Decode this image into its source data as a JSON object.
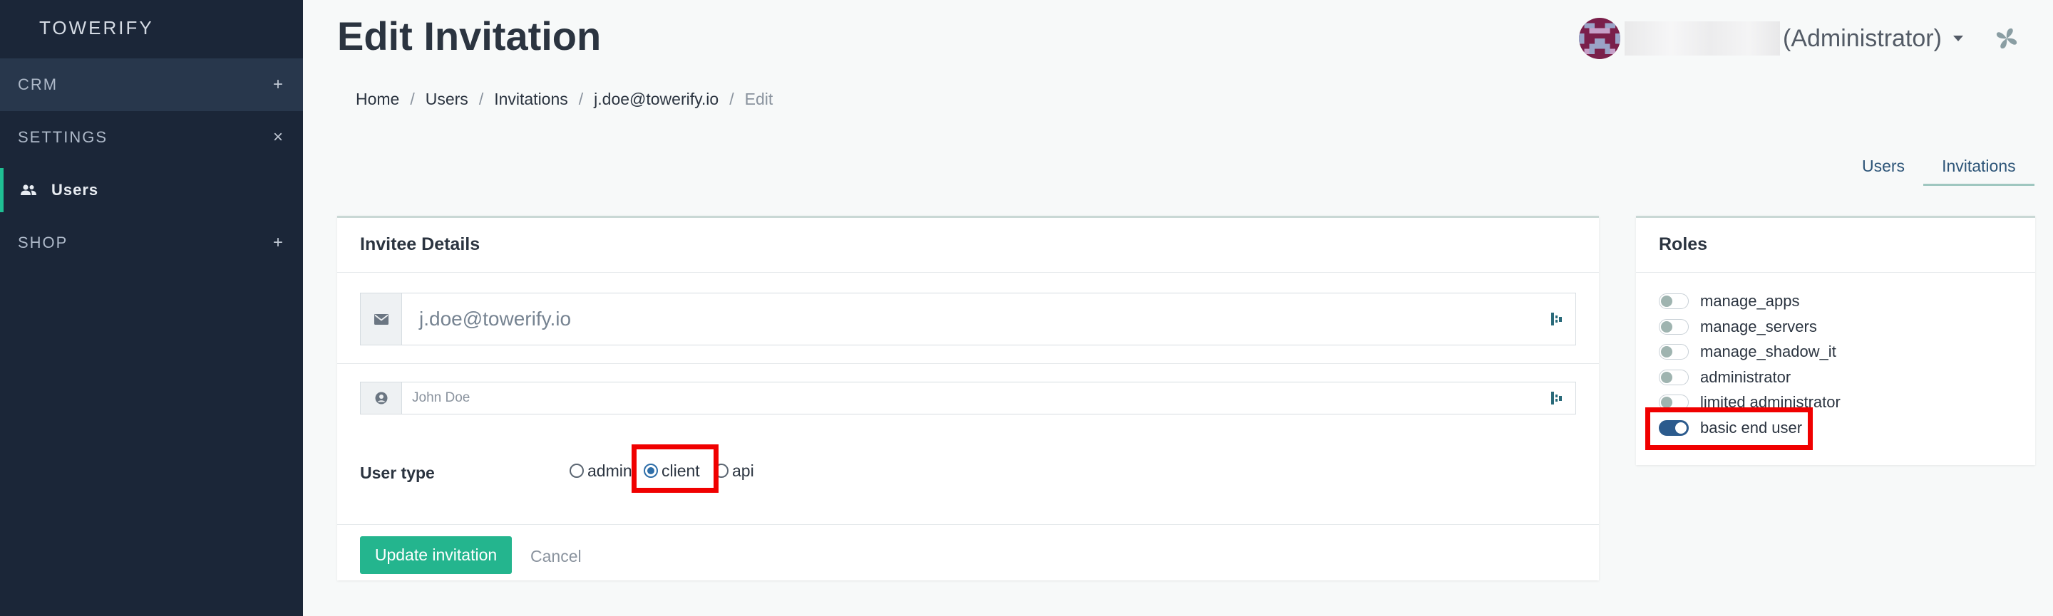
{
  "sidebar": {
    "brand": "TOWERIFY",
    "items": [
      {
        "label": "CRM",
        "toggle": "+"
      },
      {
        "label": "SETTINGS",
        "toggle": "×"
      },
      {
        "label": "Users",
        "icon": "users-icon"
      },
      {
        "label": "SHOP",
        "toggle": "+"
      }
    ]
  },
  "header": {
    "title": "Edit Invitation",
    "user_role": "(Administrator)"
  },
  "breadcrumb": [
    "Home",
    "Users",
    "Invitations",
    "j.doe@towerify.io",
    "Edit"
  ],
  "tabs": [
    "Users",
    "Invitations"
  ],
  "invitee": {
    "title": "Invitee Details",
    "email_value": "j.doe@towerify.io",
    "name_placeholder": "John Doe",
    "user_type_label": "User type",
    "user_types": [
      "admin",
      "client",
      "api"
    ],
    "selected_user_type": "client",
    "submit_label": "Update invitation",
    "cancel_label": "Cancel"
  },
  "roles": {
    "title": "Roles",
    "items": [
      {
        "label": "manage_apps",
        "enabled": false
      },
      {
        "label": "manage_servers",
        "enabled": false
      },
      {
        "label": "manage_shadow_it",
        "enabled": false
      },
      {
        "label": "administrator",
        "enabled": false
      },
      {
        "label": "limited administrator",
        "enabled": false
      },
      {
        "label": "basic end user",
        "enabled": true
      }
    ]
  },
  "colors": {
    "sidebar_bg": "#1b2638",
    "accent": "#24b58e",
    "switch_on": "#2c5b8d",
    "highlight": "#f00000"
  }
}
